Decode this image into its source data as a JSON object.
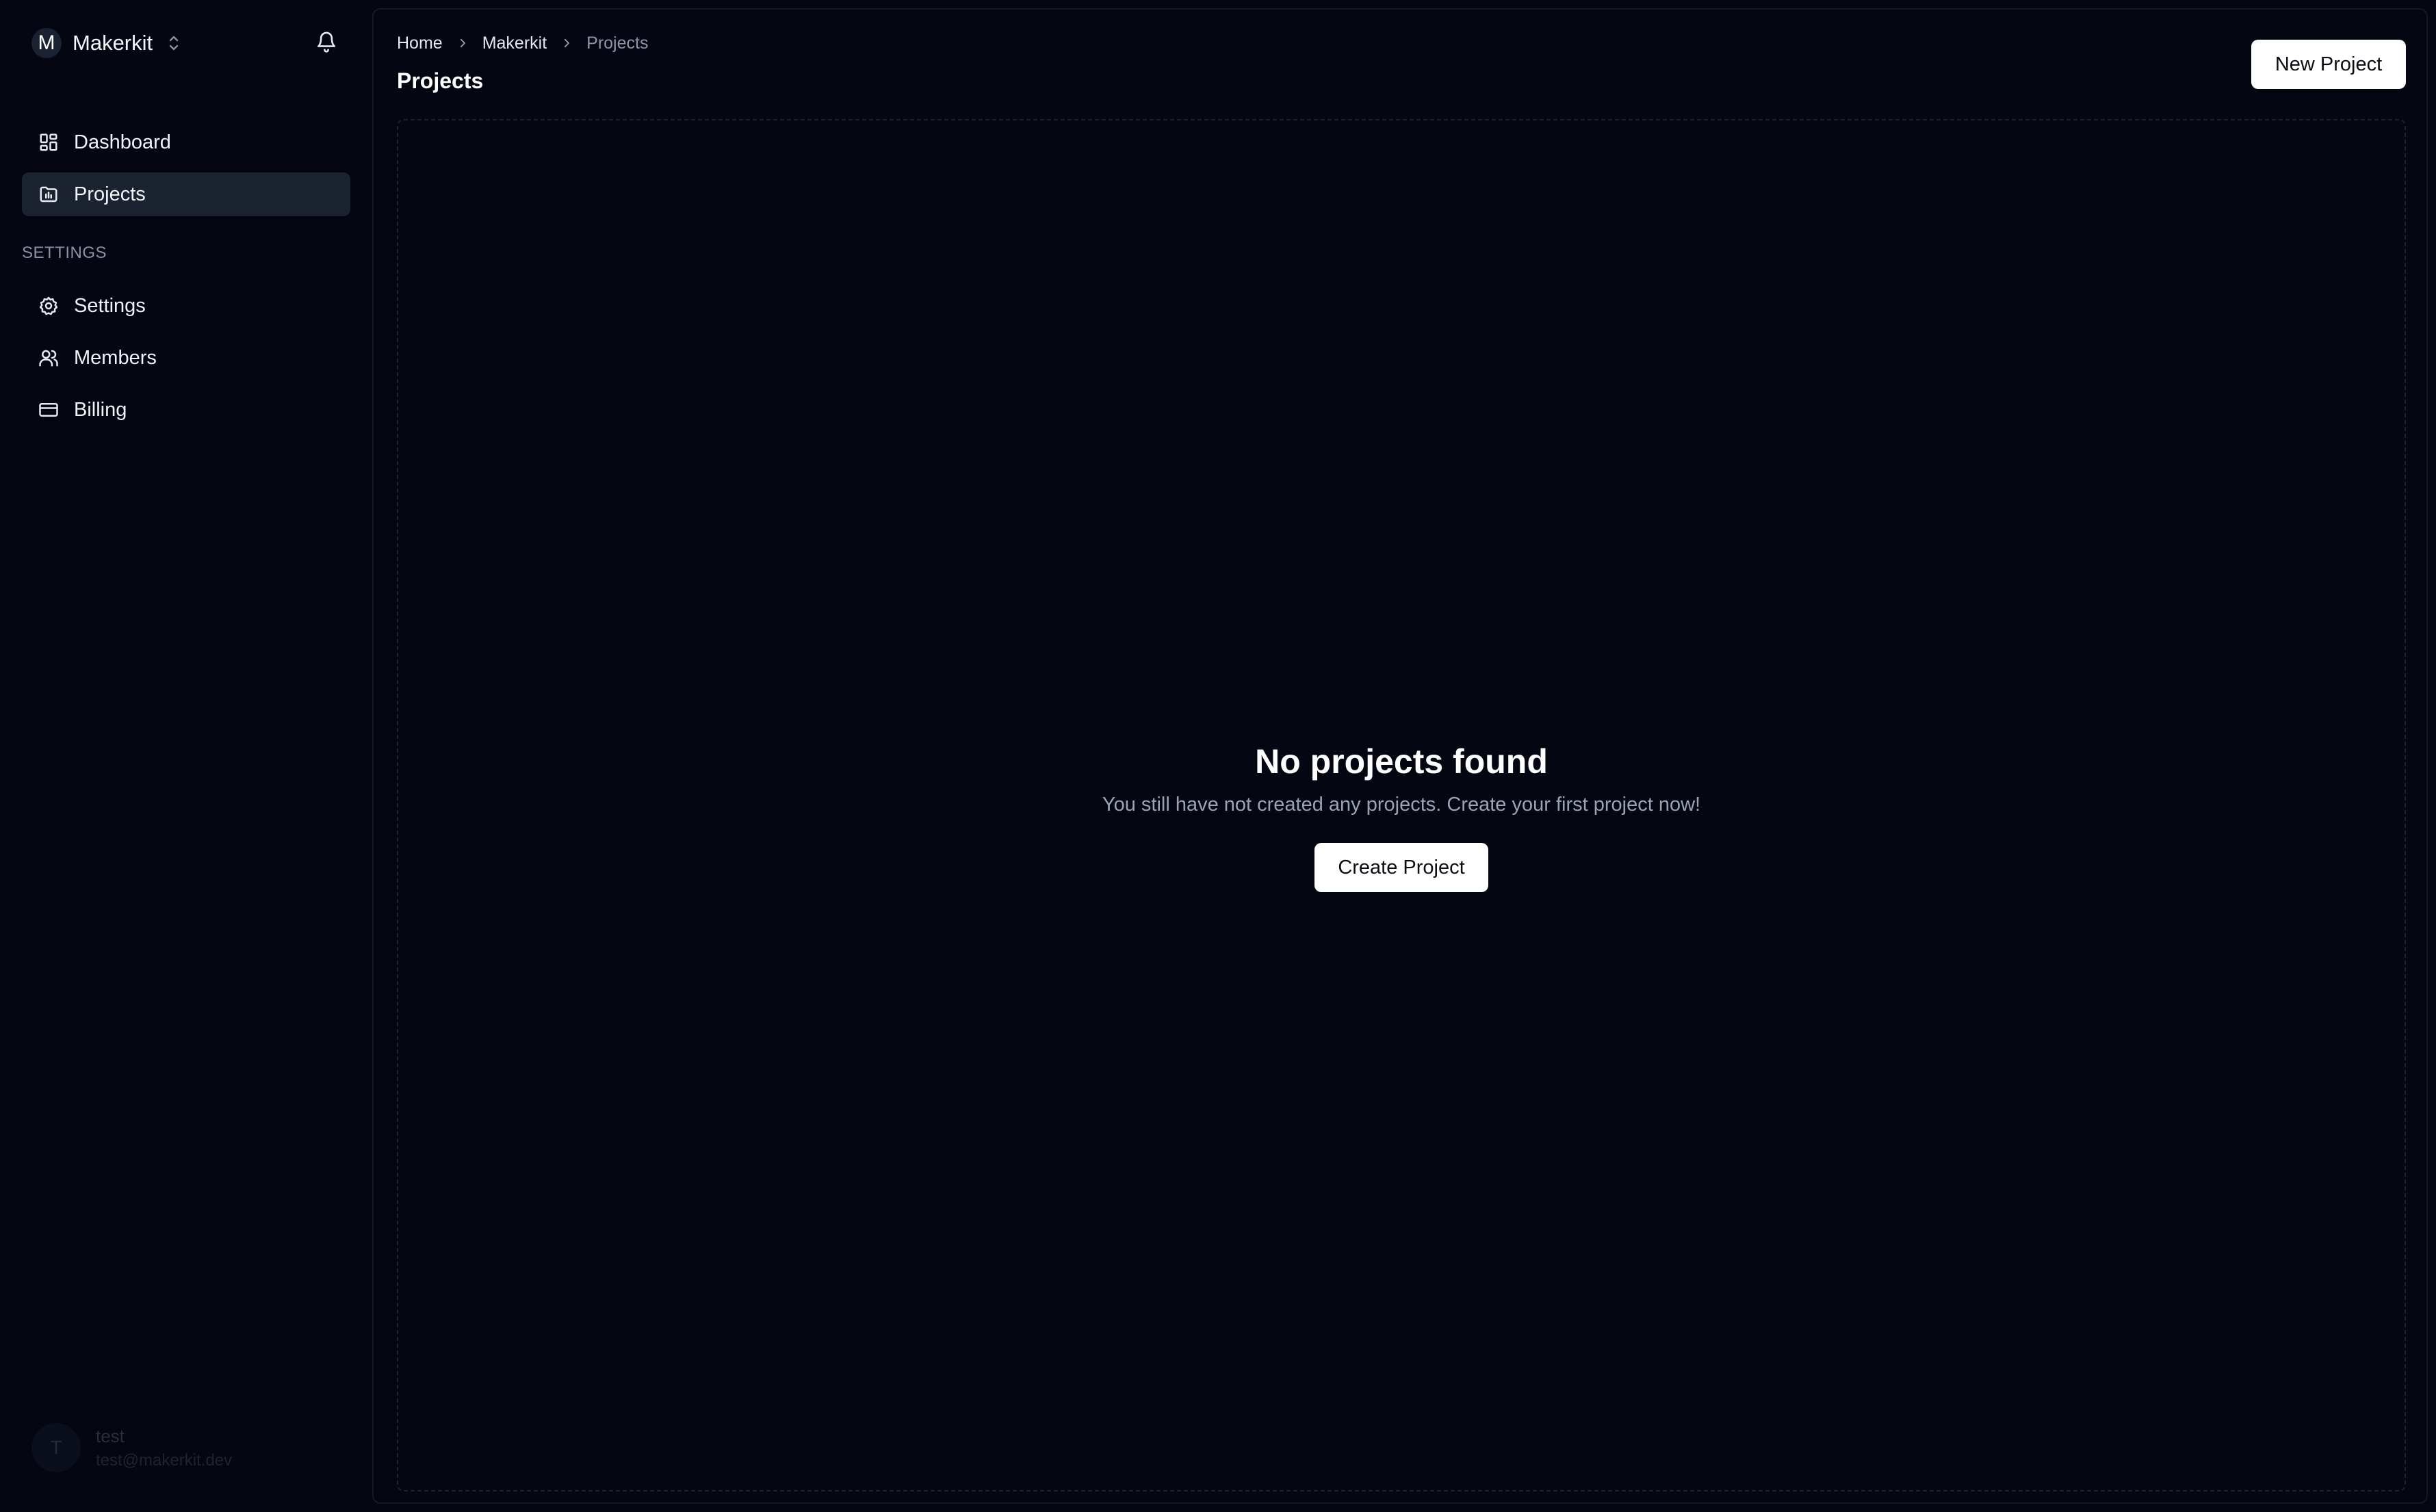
{
  "colors": {
    "background": "#040612",
    "active_nav": "#1b2230",
    "button_bg": "#ffffff",
    "muted_text": "#9ba3b3"
  },
  "account": {
    "avatar_letter": "M",
    "name": "Makerkit",
    "switch_icon": "chevron-up-down-icon",
    "notifications_icon": "bell-icon"
  },
  "sidebar": {
    "items": [
      {
        "label": "Dashboard",
        "icon": "dashboard-icon",
        "active": false
      },
      {
        "label": "Projects",
        "icon": "folder-icon",
        "active": true
      }
    ],
    "settings_section": {
      "label": "SETTINGS",
      "items": [
        {
          "label": "Settings",
          "icon": "gear-icon"
        },
        {
          "label": "Members",
          "icon": "users-icon"
        },
        {
          "label": "Billing",
          "icon": "credit-card-icon"
        }
      ]
    },
    "user": {
      "avatar_letter": "T",
      "name": "test",
      "email": "test@makerkit.dev"
    }
  },
  "header": {
    "breadcrumb": [
      "Home",
      "Makerkit",
      "Projects"
    ],
    "title": "Projects",
    "new_project_label": "New Project"
  },
  "empty_state": {
    "heading": "No projects found",
    "description": "You still have not created any projects. Create your first project now!",
    "create_label": "Create Project"
  }
}
